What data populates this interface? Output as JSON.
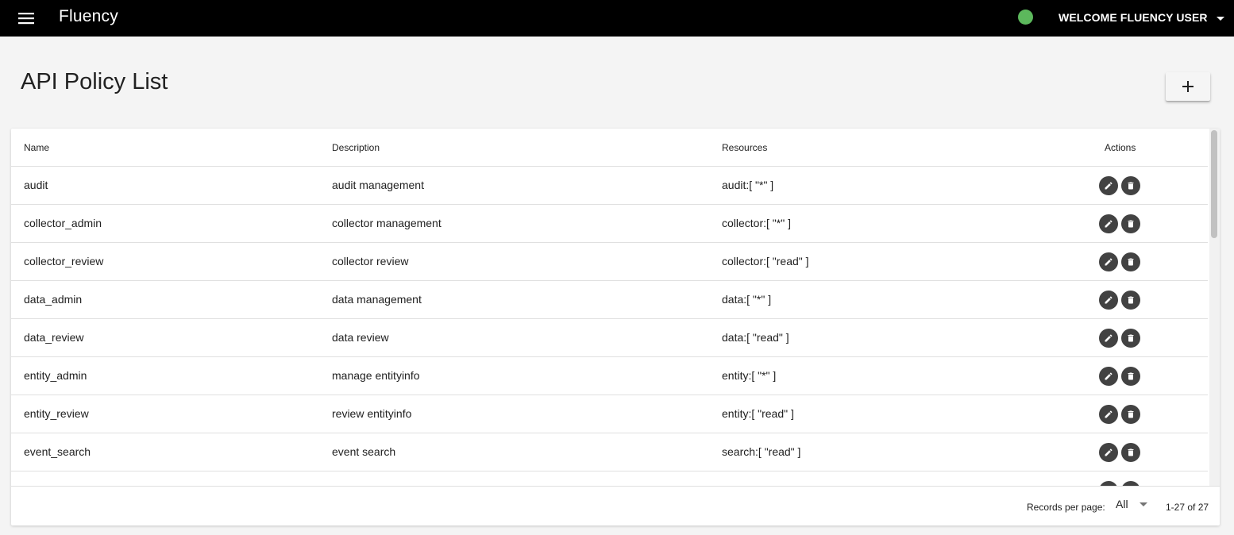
{
  "header": {
    "app_title": "Fluency",
    "user_label": "WELCOME FLUENCY USER",
    "status_color": "#5cb85c"
  },
  "page": {
    "title": "API Policy List"
  },
  "table": {
    "columns": [
      "Name",
      "Description",
      "Resources",
      "Actions"
    ],
    "rows": [
      {
        "name": "audit",
        "description": "audit management",
        "resources": "audit:[ \"*\" ]"
      },
      {
        "name": "collector_admin",
        "description": "collector management",
        "resources": "collector:[ \"*\" ]"
      },
      {
        "name": "collector_review",
        "description": "collector review",
        "resources": "collector:[ \"read\" ]"
      },
      {
        "name": "data_admin",
        "description": "data management",
        "resources": "data:[ \"*\" ]"
      },
      {
        "name": "data_review",
        "description": "data review",
        "resources": "data:[ \"read\" ]"
      },
      {
        "name": "entity_admin",
        "description": "manage entityinfo",
        "resources": "entity:[ \"*\" ]"
      },
      {
        "name": "entity_review",
        "description": "review entityinfo",
        "resources": "entity:[ \"read\" ]"
      },
      {
        "name": "event_search",
        "description": "event search",
        "resources": "search:[ \"read\" ]"
      }
    ]
  },
  "footer": {
    "records_per_page_label": "Records per page:",
    "records_per_page_value": "All",
    "range": "1-27 of 27"
  },
  "icons": {
    "menu": "menu-icon",
    "add": "plus-icon",
    "edit": "pencil-icon",
    "delete": "trash-icon"
  }
}
